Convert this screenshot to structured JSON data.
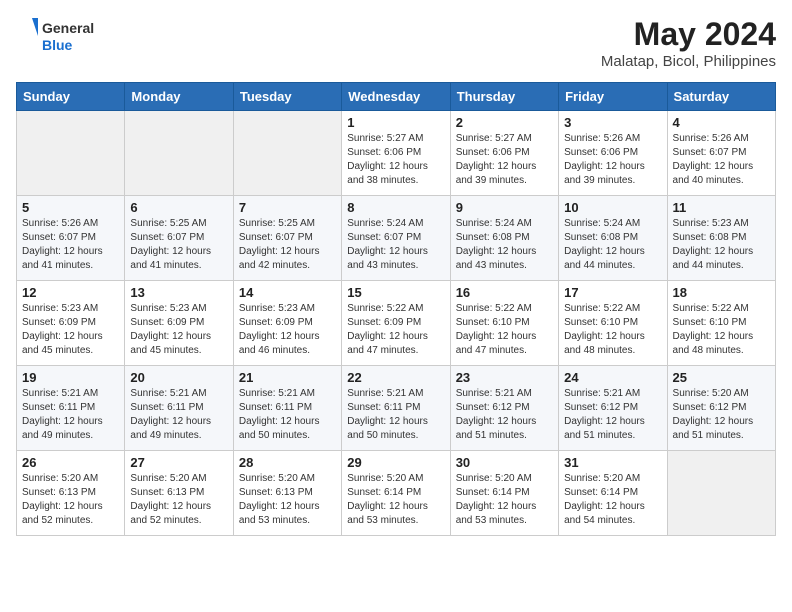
{
  "header": {
    "logo_general": "General",
    "logo_blue": "Blue",
    "month_year": "May 2024",
    "location": "Malatap, Bicol, Philippines"
  },
  "days_of_week": [
    "Sunday",
    "Monday",
    "Tuesday",
    "Wednesday",
    "Thursday",
    "Friday",
    "Saturday"
  ],
  "weeks": [
    [
      {
        "day": "",
        "info": ""
      },
      {
        "day": "",
        "info": ""
      },
      {
        "day": "",
        "info": ""
      },
      {
        "day": "1",
        "info": "Sunrise: 5:27 AM\nSunset: 6:06 PM\nDaylight: 12 hours\nand 38 minutes."
      },
      {
        "day": "2",
        "info": "Sunrise: 5:27 AM\nSunset: 6:06 PM\nDaylight: 12 hours\nand 39 minutes."
      },
      {
        "day": "3",
        "info": "Sunrise: 5:26 AM\nSunset: 6:06 PM\nDaylight: 12 hours\nand 39 minutes."
      },
      {
        "day": "4",
        "info": "Sunrise: 5:26 AM\nSunset: 6:07 PM\nDaylight: 12 hours\nand 40 minutes."
      }
    ],
    [
      {
        "day": "5",
        "info": "Sunrise: 5:26 AM\nSunset: 6:07 PM\nDaylight: 12 hours\nand 41 minutes."
      },
      {
        "day": "6",
        "info": "Sunrise: 5:25 AM\nSunset: 6:07 PM\nDaylight: 12 hours\nand 41 minutes."
      },
      {
        "day": "7",
        "info": "Sunrise: 5:25 AM\nSunset: 6:07 PM\nDaylight: 12 hours\nand 42 minutes."
      },
      {
        "day": "8",
        "info": "Sunrise: 5:24 AM\nSunset: 6:07 PM\nDaylight: 12 hours\nand 43 minutes."
      },
      {
        "day": "9",
        "info": "Sunrise: 5:24 AM\nSunset: 6:08 PM\nDaylight: 12 hours\nand 43 minutes."
      },
      {
        "day": "10",
        "info": "Sunrise: 5:24 AM\nSunset: 6:08 PM\nDaylight: 12 hours\nand 44 minutes."
      },
      {
        "day": "11",
        "info": "Sunrise: 5:23 AM\nSunset: 6:08 PM\nDaylight: 12 hours\nand 44 minutes."
      }
    ],
    [
      {
        "day": "12",
        "info": "Sunrise: 5:23 AM\nSunset: 6:09 PM\nDaylight: 12 hours\nand 45 minutes."
      },
      {
        "day": "13",
        "info": "Sunrise: 5:23 AM\nSunset: 6:09 PM\nDaylight: 12 hours\nand 45 minutes."
      },
      {
        "day": "14",
        "info": "Sunrise: 5:23 AM\nSunset: 6:09 PM\nDaylight: 12 hours\nand 46 minutes."
      },
      {
        "day": "15",
        "info": "Sunrise: 5:22 AM\nSunset: 6:09 PM\nDaylight: 12 hours\nand 47 minutes."
      },
      {
        "day": "16",
        "info": "Sunrise: 5:22 AM\nSunset: 6:10 PM\nDaylight: 12 hours\nand 47 minutes."
      },
      {
        "day": "17",
        "info": "Sunrise: 5:22 AM\nSunset: 6:10 PM\nDaylight: 12 hours\nand 48 minutes."
      },
      {
        "day": "18",
        "info": "Sunrise: 5:22 AM\nSunset: 6:10 PM\nDaylight: 12 hours\nand 48 minutes."
      }
    ],
    [
      {
        "day": "19",
        "info": "Sunrise: 5:21 AM\nSunset: 6:11 PM\nDaylight: 12 hours\nand 49 minutes."
      },
      {
        "day": "20",
        "info": "Sunrise: 5:21 AM\nSunset: 6:11 PM\nDaylight: 12 hours\nand 49 minutes."
      },
      {
        "day": "21",
        "info": "Sunrise: 5:21 AM\nSunset: 6:11 PM\nDaylight: 12 hours\nand 50 minutes."
      },
      {
        "day": "22",
        "info": "Sunrise: 5:21 AM\nSunset: 6:11 PM\nDaylight: 12 hours\nand 50 minutes."
      },
      {
        "day": "23",
        "info": "Sunrise: 5:21 AM\nSunset: 6:12 PM\nDaylight: 12 hours\nand 51 minutes."
      },
      {
        "day": "24",
        "info": "Sunrise: 5:21 AM\nSunset: 6:12 PM\nDaylight: 12 hours\nand 51 minutes."
      },
      {
        "day": "25",
        "info": "Sunrise: 5:20 AM\nSunset: 6:12 PM\nDaylight: 12 hours\nand 51 minutes."
      }
    ],
    [
      {
        "day": "26",
        "info": "Sunrise: 5:20 AM\nSunset: 6:13 PM\nDaylight: 12 hours\nand 52 minutes."
      },
      {
        "day": "27",
        "info": "Sunrise: 5:20 AM\nSunset: 6:13 PM\nDaylight: 12 hours\nand 52 minutes."
      },
      {
        "day": "28",
        "info": "Sunrise: 5:20 AM\nSunset: 6:13 PM\nDaylight: 12 hours\nand 53 minutes."
      },
      {
        "day": "29",
        "info": "Sunrise: 5:20 AM\nSunset: 6:14 PM\nDaylight: 12 hours\nand 53 minutes."
      },
      {
        "day": "30",
        "info": "Sunrise: 5:20 AM\nSunset: 6:14 PM\nDaylight: 12 hours\nand 53 minutes."
      },
      {
        "day": "31",
        "info": "Sunrise: 5:20 AM\nSunset: 6:14 PM\nDaylight: 12 hours\nand 54 minutes."
      },
      {
        "day": "",
        "info": ""
      }
    ]
  ]
}
